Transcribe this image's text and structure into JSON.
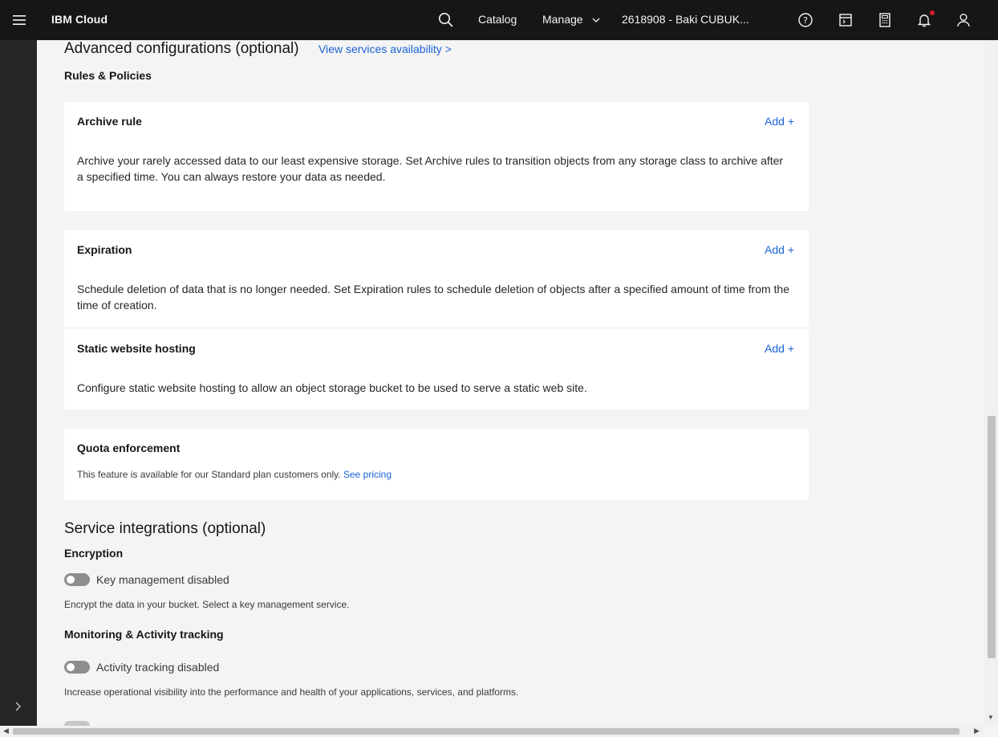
{
  "header": {
    "brand": "IBM Cloud",
    "nav": {
      "catalog": "Catalog",
      "manage": "Manage"
    },
    "account": "2618908 - Baki CUBUK...",
    "icons": [
      "menu-icon",
      "search-icon",
      "help-icon",
      "cost-estimator-icon",
      "calculator-icon",
      "notification-icon",
      "user-icon"
    ]
  },
  "advanced": {
    "title": "Advanced configurations (optional)",
    "services_link": "View services availability >",
    "rules_heading": "Rules & Policies"
  },
  "cards": {
    "archive": {
      "title": "Archive rule",
      "add": "Add +",
      "desc": "Archive your rarely accessed data to our least expensive storage. Set Archive rules to transition objects from any storage class to archive after a specified time. You can always restore your data as needed."
    },
    "expiration": {
      "title": "Expiration",
      "add": "Add +",
      "desc": "Schedule deletion of data that is no longer needed. Set Expiration rules to schedule deletion of objects after a specified amount of time from the time of creation."
    },
    "static": {
      "title": "Static website hosting",
      "add": "Add +",
      "desc": "Configure static website hosting to allow an object storage bucket to be used to serve a static web site."
    },
    "quota": {
      "title": "Quota enforcement",
      "desc": "This feature is available for our Standard plan customers only.",
      "link": "See pricing"
    }
  },
  "service": {
    "title": "Service integrations (optional)",
    "encryption": {
      "heading": "Encryption",
      "toggle_label": "Key management disabled",
      "toggle_on": false,
      "helper": "Encrypt the data in your bucket. Select a key management service."
    },
    "monitoring": {
      "heading": "Monitoring & Activity tracking",
      "toggle_label": "Activity tracking disabled",
      "toggle_on": false,
      "helper": "Increase operational visibility into the performance and health of your applications, services, and platforms."
    }
  },
  "colors": {
    "topbar": "#161616",
    "link": "#1a63d6",
    "page_bg": "#f4f4f4",
    "card_bg": "#ffffff",
    "notification_dot": "#da1e28"
  }
}
